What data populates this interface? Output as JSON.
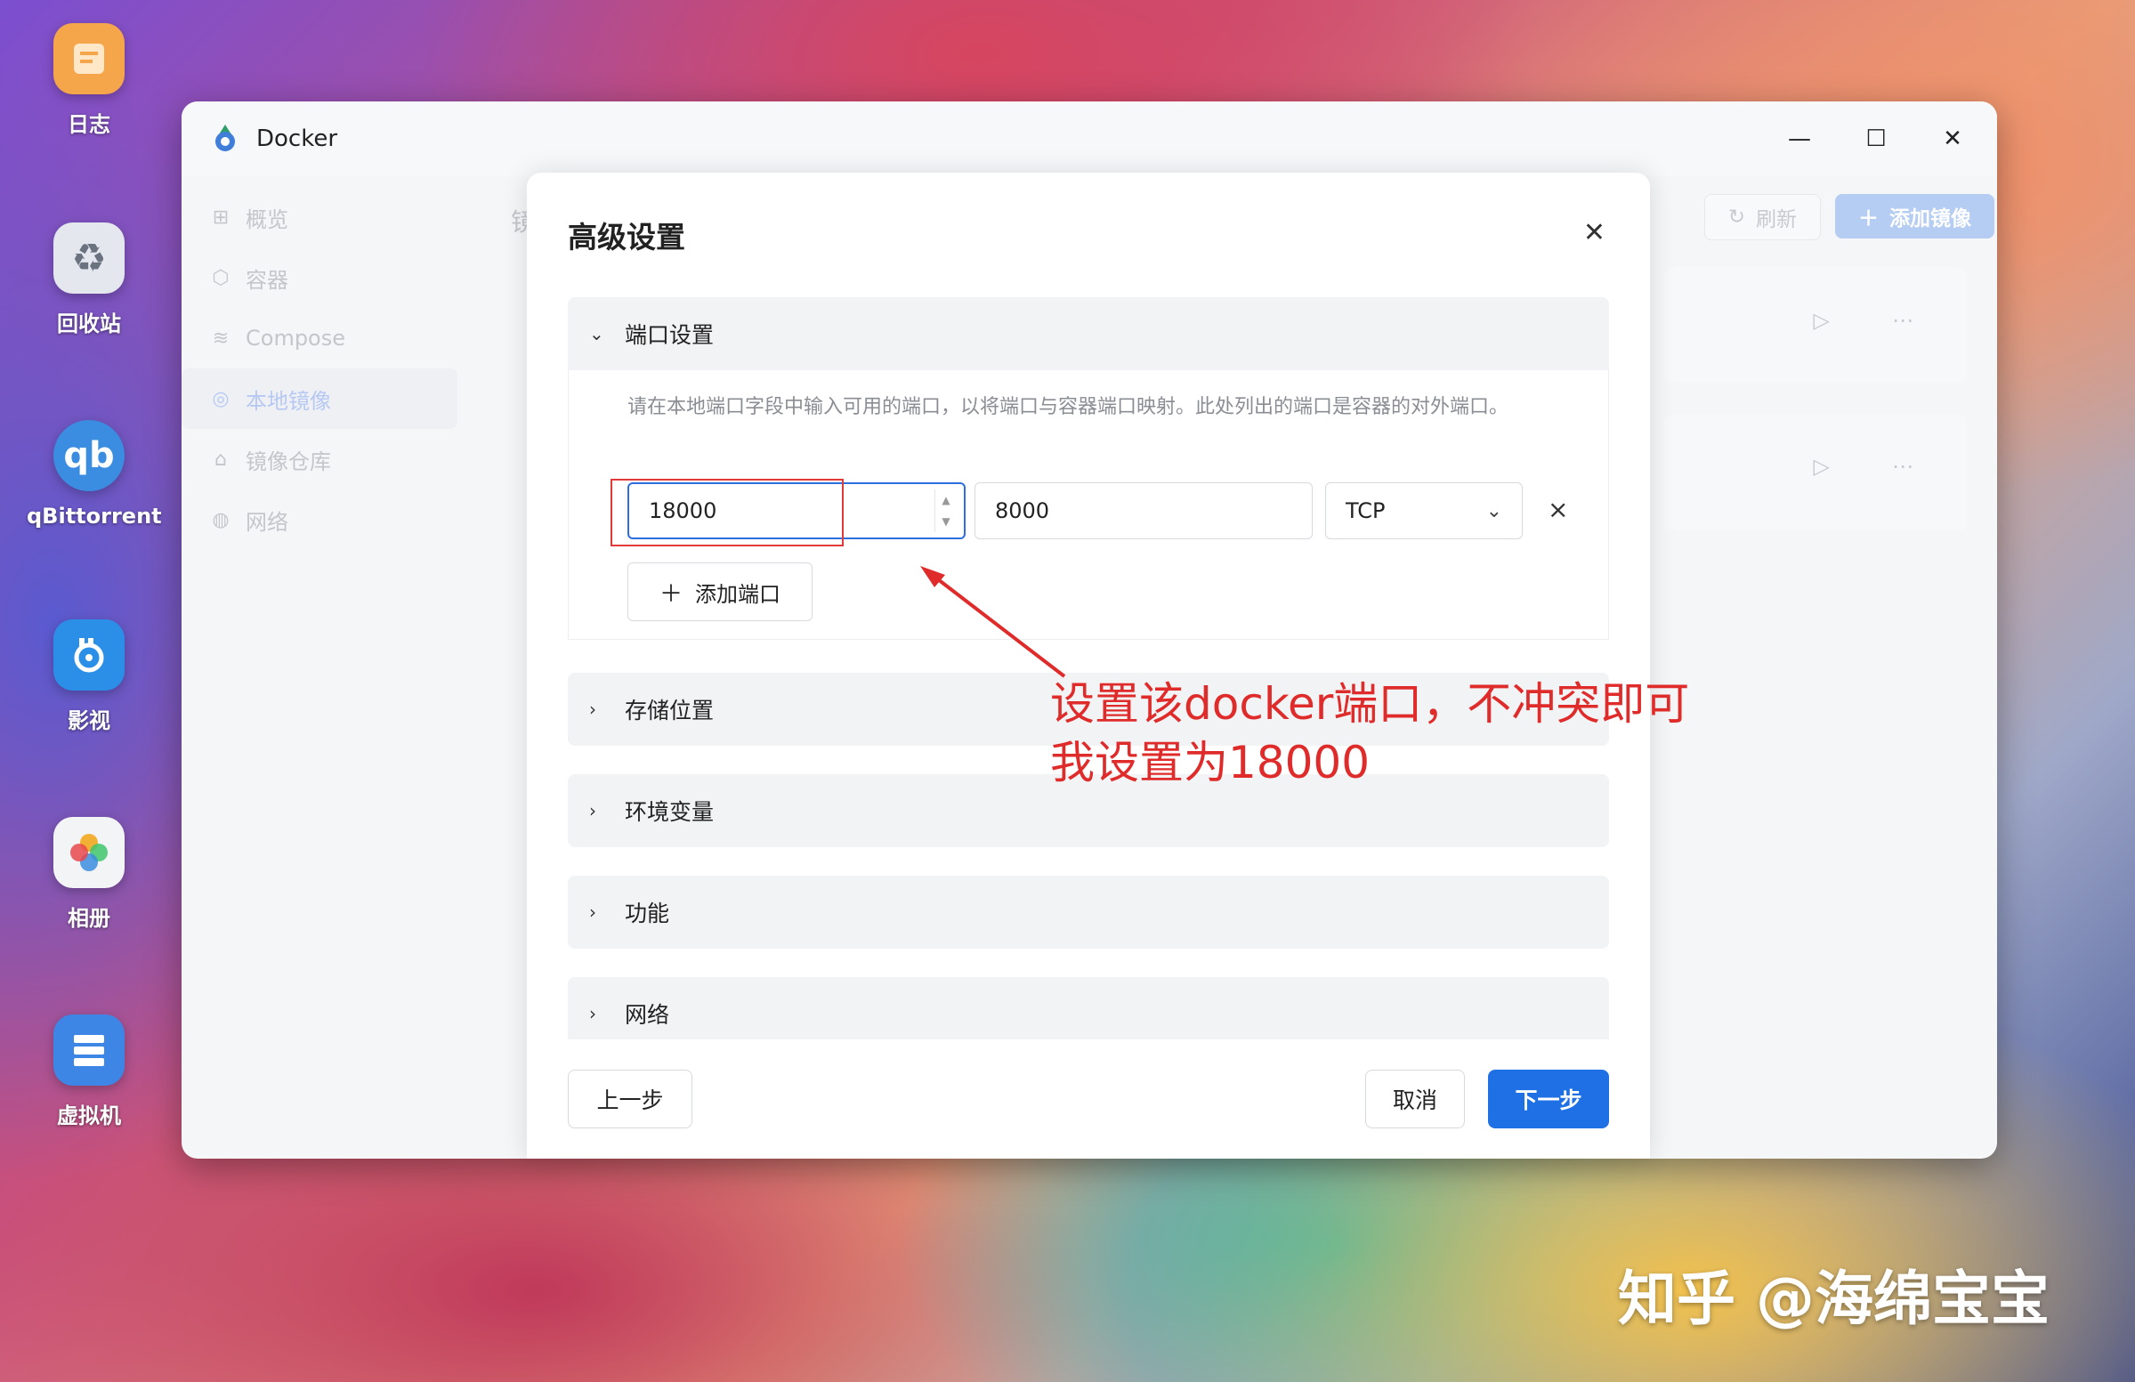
{
  "desktop": {
    "icons": [
      {
        "label": "日志",
        "icon": "log-icon",
        "color": "#f6a64a"
      },
      {
        "label": "回收站",
        "icon": "recycle-icon",
        "color": "#d5d9e2"
      },
      {
        "label": "qBittorrent",
        "icon": "qbittorrent-icon",
        "color": "#3a8de0"
      },
      {
        "label": "影视",
        "icon": "video-icon",
        "color": "#2b8fe8"
      },
      {
        "label": "相册",
        "icon": "photos-icon",
        "color": "#f3f4f6"
      },
      {
        "label": "虚拟机",
        "icon": "vm-icon",
        "color": "#3e86e6"
      }
    ],
    "qb_glyph": "qb"
  },
  "window": {
    "title": "Docker",
    "controls": {
      "minimize": "—",
      "maximize": "☐",
      "close": "✕"
    }
  },
  "sidebar": {
    "items": [
      {
        "label": "概览",
        "icon": "grid-icon"
      },
      {
        "label": "容器",
        "icon": "cube-icon"
      },
      {
        "label": "Compose",
        "icon": "layers-icon"
      },
      {
        "label": "本地镜像",
        "icon": "disc-icon",
        "active": true
      },
      {
        "label": "镜像仓库",
        "icon": "home-icon"
      },
      {
        "label": "网络",
        "icon": "globe-icon"
      }
    ]
  },
  "toolbar": {
    "refresh_label": "刷新",
    "add_image_label": "添加镜像"
  },
  "background_partial_text": "镜",
  "dialog": {
    "title": "高级设置",
    "sections": {
      "ports": {
        "title": "端口设置",
        "hint": "请在本地端口字段中输入可用的端口，以将端口与容器端口映射。此处列出的端口是容器的对外端口。",
        "rows": [
          {
            "local_port": "18000",
            "container_port": "8000",
            "protocol": "TCP"
          }
        ],
        "add_label": "添加端口"
      },
      "storage": {
        "title": "存储位置"
      },
      "env": {
        "title": "环境变量"
      },
      "features": {
        "title": "功能"
      },
      "network": {
        "title": "网络"
      }
    },
    "footer": {
      "prev_label": "上一步",
      "cancel_label": "取消",
      "next_label": "下一步"
    }
  },
  "annotation": {
    "line1": "设置该docker端口，不冲突即可",
    "line2": "我设置为18000",
    "color": "#e02b2b"
  },
  "watermark": "知乎 @海绵宝宝"
}
